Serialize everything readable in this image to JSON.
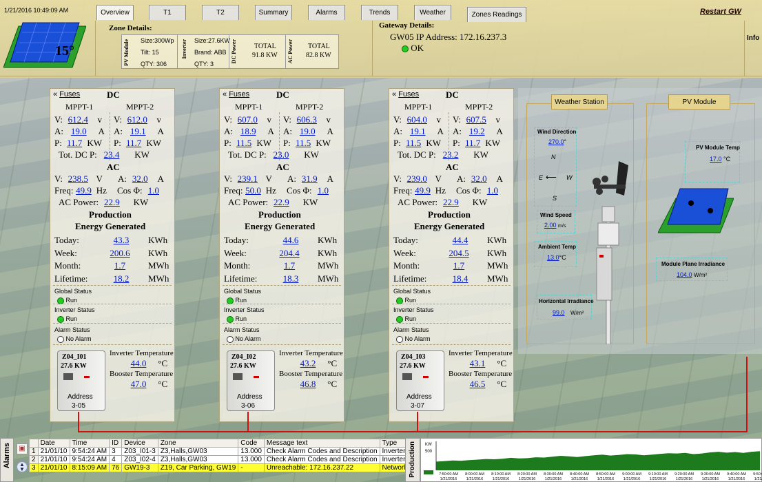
{
  "header": {
    "datetime": "1/21/2016 10:49:09 AM",
    "tabs": [
      {
        "label": "Overview",
        "active": true
      },
      {
        "label": "T1"
      },
      {
        "label": "T2"
      },
      {
        "label": "Summary"
      },
      {
        "label": "Alarms"
      },
      {
        "label": "Trends"
      },
      {
        "label": "Weather"
      },
      {
        "label": "Zones Readings"
      }
    ],
    "restart_label": "Restart GW",
    "info_label": "Info",
    "temperature": "15°"
  },
  "zone_details": {
    "title": "Zone Details:",
    "pv_module_label": "PV Module",
    "pv_size": "Size:300Wp",
    "pv_tilt": "Tilt: 15",
    "pv_qty": "QTY: 306",
    "inverter_label": "Inverter",
    "inv_size": "Size:27.6KW",
    "inv_brand": "Brand: ABB",
    "inv_qty": "QTY: 3",
    "dc_power_label": "DC Power",
    "dc_total_label": "TOTAL",
    "dc_total": "91.8 KW",
    "ac_power_label": "AC Power",
    "ac_total_label": "TOTAL",
    "ac_total": "82.8 KW"
  },
  "gateway": {
    "title": "Gateway Details:",
    "ip": "GW05 IP Address: 172.16.237.3",
    "status": "OK"
  },
  "labels": {
    "fuses": "Fuses",
    "dc": "DC",
    "mppt1": "MPPT-1",
    "mppt2": "MPPT-2",
    "v": "V:",
    "a": "A:",
    "p": "P:",
    "unit_v": "v",
    "unit_v_ac": "V",
    "unit_a": "A",
    "unit_kw": "KW",
    "tot_dc": "Tot. DC P:",
    "ac": "AC",
    "freq": "Freq:",
    "hz": "Hz",
    "cos": "Cos Φ:",
    "ac_power": "AC Power:",
    "production": "Production",
    "energy": "Energy Generated",
    "today": "Today:",
    "week": "Week:",
    "month": "Month:",
    "lifetime": "Lifetime:",
    "kwh": "KWh",
    "mwh": "MWh",
    "global_status": "Global Status",
    "inverter_status": "Inverter Status",
    "alarm_status": "Alarm Status",
    "run": "Run",
    "no_alarm": "No Alarm",
    "inv_temp": "Inverter Temperature",
    "boost_temp": "Booster Temperature",
    "degc": "°C",
    "address": "Address"
  },
  "inverters": [
    {
      "name": "Z04_I01",
      "rating": "27.6 KW",
      "m1v": "612.4",
      "m2v": "612.0",
      "m1a": "19.0",
      "m2a": "19.1",
      "m1p": "11.7",
      "m2p": "11.7",
      "totdc": "23.4",
      "acv": "238.5",
      "aca": "32.0",
      "freq": "49.9",
      "cos": "1.0",
      "acp": "22.9",
      "today": "43.3",
      "week": "200.6",
      "month": "1.7",
      "lifetime": "18.2",
      "invtemp": "44.0",
      "booster": "47.0",
      "address": "3-05"
    },
    {
      "name": "Z04_I02",
      "rating": "27.6 KW",
      "m1v": "607.0",
      "m2v": "606.3",
      "m1a": "18.9",
      "m2a": "19.0",
      "m1p": "11.5",
      "m2p": "11.5",
      "totdc": "23.0",
      "acv": "239.1",
      "aca": "31.9",
      "freq": "50.0",
      "cos": "1.0",
      "acp": "22.9",
      "today": "44.6",
      "week": "204.4",
      "month": "1.7",
      "lifetime": "18.3",
      "invtemp": "43.2",
      "booster": "46.8",
      "address": "3-06"
    },
    {
      "name": "Z04_I03",
      "rating": "27.6 KW",
      "m1v": "604.0",
      "m2v": "607.5",
      "m1a": "19.1",
      "m2a": "19.2",
      "m1p": "11.5",
      "m2p": "11.7",
      "totdc": "23.2",
      "acv": "239.0",
      "aca": "32.0",
      "freq": "49.9",
      "cos": "1.0",
      "acp": "22.9",
      "today": "44.4",
      "week": "204.5",
      "month": "1.7",
      "lifetime": "18.4",
      "invtemp": "43.1",
      "booster": "46.5",
      "address": "3-07"
    }
  ],
  "weather": {
    "station_title": "Weather Station",
    "pv_module_title": "PV Module",
    "wind_dir_label": "Wind Direction",
    "wind_dir_value": "270.0",
    "wind_dir_unit": "°",
    "compass_n": "N",
    "compass_e": "E",
    "compass_w": "W",
    "compass_s": "S",
    "wind_speed_label": "Wind Speed",
    "wind_speed_value": "2.00",
    "wind_speed_unit": "m/s",
    "ambient_label": "Ambient Temp",
    "ambient_value": "13.0",
    "ambient_unit": "°C",
    "horiz_label": "Horizontal Irradiance",
    "horiz_value": "99.0",
    "horiz_unit": "W/m²",
    "pv_temp_label": "PV Module Temp",
    "pv_temp_value": "17.0",
    "pv_temp_unit": "°C",
    "plane_label": "Module Plane Irradiance",
    "plane_value": "104.0",
    "plane_unit": "W/m²"
  },
  "alarms": {
    "side_label": "Alarms",
    "columns": [
      "Date",
      "Time",
      "ID",
      "Device",
      "Zone",
      "Code",
      "Message text",
      "Type"
    ],
    "rows": [
      {
        "n": "1",
        "date": "21/01/10",
        "time": "9:54:24 AM",
        "id": "3",
        "device": "Z03_I01-3",
        "zone": "Z3,Halls,GW03",
        "code": "13.000",
        "msg": "Check Alarm Codes and Description",
        "type": "Inverter"
      },
      {
        "n": "2",
        "date": "21/01/10",
        "time": "9:54:24 AM",
        "id": "4",
        "device": "Z03_I02-4",
        "zone": "Z3,Halls,GW03",
        "code": "13.000",
        "msg": "Check Alarm Codes and Description",
        "type": "Inverter"
      },
      {
        "n": "3",
        "date": "21/01/10",
        "time": "8:15:09 AM",
        "id": "76",
        "device": "GW19-3",
        "zone": "Z19, Car Parking, GW19",
        "code": "-",
        "msg": "Unreachable: 172.16.237.22",
        "type": "Network"
      }
    ]
  },
  "production_chart": {
    "side_label": "Production",
    "unit_label": "KW",
    "y_tick": "500",
    "ticks": [
      {
        "time": "7:50:00 AM",
        "date": "1/21/2016"
      },
      {
        "time": "8:00:00 AM",
        "date": "1/21/2016"
      },
      {
        "time": "8:10:00 AM",
        "date": "1/21/2016"
      },
      {
        "time": "8:20:00 AM",
        "date": "1/21/2016"
      },
      {
        "time": "8:30:00 AM",
        "date": "1/21/2016"
      },
      {
        "time": "8:40:00 AM",
        "date": "1/21/2016"
      },
      {
        "time": "8:50:00 AM",
        "date": "1/21/2016"
      },
      {
        "time": "9:00:00 AM",
        "date": "1/21/2016"
      },
      {
        "time": "9:10:00 AM",
        "date": "1/21/2016"
      },
      {
        "time": "9:20:00 AM",
        "date": "1/21/2016"
      },
      {
        "time": "9:30:00 AM",
        "date": "1/21/2016"
      },
      {
        "time": "9:40:00 AM",
        "date": "1/21/2016"
      },
      {
        "time": "9:50:00 AM",
        "date": "1/21/2016"
      }
    ],
    "series_color": "#1d7a1d",
    "values": [
      150,
      160,
      170,
      165,
      175,
      185,
      195,
      190,
      200,
      215,
      205,
      210,
      225,
      220,
      235,
      250,
      240,
      230,
      245,
      260,
      270,
      255,
      265,
      280,
      275,
      260,
      270,
      285,
      295,
      290,
      300,
      280,
      290,
      310,
      320,
      305,
      315,
      300,
      320,
      330
    ]
  },
  "colors": {
    "accent": "#0018c8",
    "ok_green": "#22cc22",
    "alarm_line": "#d01010"
  }
}
